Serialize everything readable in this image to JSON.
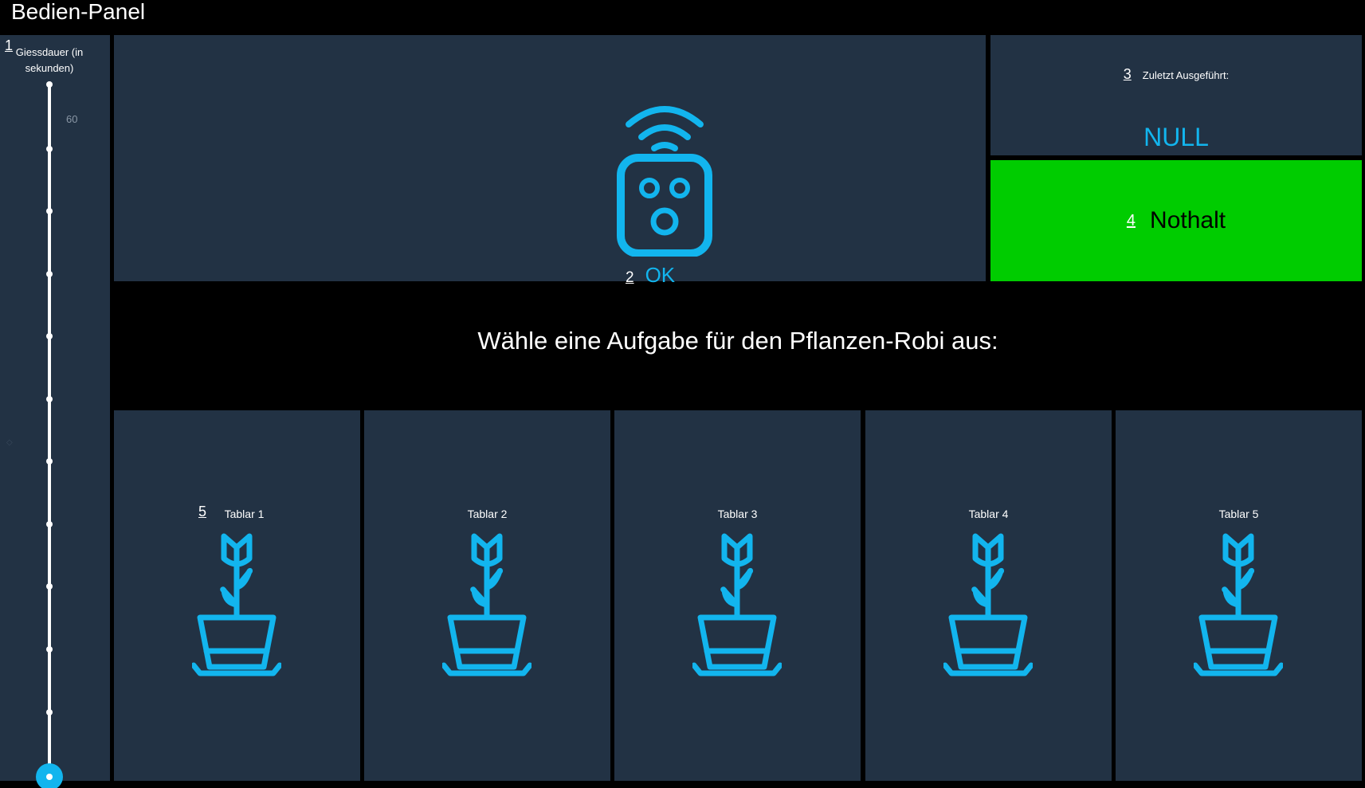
{
  "app": {
    "title": "Bedien-Panel"
  },
  "markers": {
    "slider": "1",
    "status": "2",
    "last": "3",
    "stop": "4",
    "tray": "5"
  },
  "slider": {
    "label": "Giessdauer (in sekunden)",
    "max_label": "60",
    "min_label": "5",
    "min": 5,
    "max": 60,
    "value": 5,
    "side_mark": "◇",
    "thumb_color": "#12b5ee"
  },
  "status": {
    "icon": "remote-control-icon",
    "text": "OK",
    "color": "#12b5ee"
  },
  "last_executed": {
    "label": "Zuletzt Ausgeführt:",
    "value": "NULL"
  },
  "emergency_stop": {
    "label": "Nothalt",
    "color": "#00cc00"
  },
  "prompt": "Wähle eine Aufgabe für den Pflanzen-Robi aus:",
  "trays": [
    {
      "label": "Tablar 1",
      "icon": "plant-pot-icon"
    },
    {
      "label": "Tablar 2",
      "icon": "plant-pot-icon"
    },
    {
      "label": "Tablar 3",
      "icon": "plant-pot-icon"
    },
    {
      "label": "Tablar 4",
      "icon": "plant-pot-icon"
    },
    {
      "label": "Tablar 5",
      "icon": "plant-pot-icon"
    }
  ],
  "colors": {
    "tile": "#223244",
    "accent": "#12b5ee",
    "background": "#000000"
  }
}
